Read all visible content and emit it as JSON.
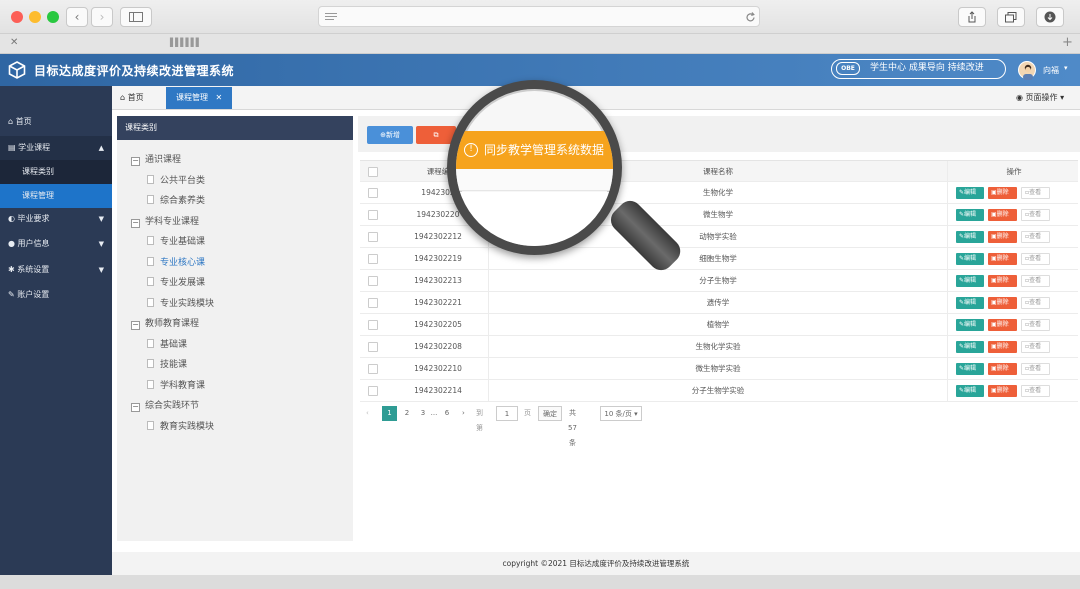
{
  "browser": {
    "tab_title": "▌▌▌▌▌▌",
    "close_tab": "✕",
    "new_tab": "+"
  },
  "app": {
    "title": "目标达成度评价及持续改进管理系统",
    "obe_badge": "OBE",
    "obe_slogan": "学生中心  成果导向  持续改进",
    "user_name": "向福"
  },
  "sidebar": {
    "items": [
      {
        "label": "首页",
        "icon": "home-icon"
      },
      {
        "label": "学业课程",
        "icon": "document-icon",
        "expanded": true
      },
      {
        "label": "课程类别",
        "sub": true
      },
      {
        "label": "课程管理",
        "sub": true,
        "active": true
      },
      {
        "label": "毕业要求",
        "icon": "target-icon"
      },
      {
        "label": "用户信息",
        "icon": "user-icon"
      },
      {
        "label": "系统设置",
        "icon": "gear-icon"
      },
      {
        "label": "账户设置",
        "icon": "edit-icon"
      }
    ]
  },
  "tabs": {
    "home": "首页",
    "active": "课程管理",
    "page_ops": "页面操作"
  },
  "category_panel": {
    "header": "课程类别",
    "tree": [
      {
        "label": "通识课程",
        "level": 0
      },
      {
        "label": "公共平台类",
        "level": 1
      },
      {
        "label": "综合素养类",
        "level": 1
      },
      {
        "label": "学科专业课程",
        "level": 0
      },
      {
        "label": "专业基础课",
        "level": 1
      },
      {
        "label": "专业核心课",
        "level": 1,
        "selected": true
      },
      {
        "label": "专业发展课",
        "level": 1
      },
      {
        "label": "专业实践模块",
        "level": 1
      },
      {
        "label": "教师教育课程",
        "level": 0
      },
      {
        "label": "基础课",
        "level": 1
      },
      {
        "label": "技能课",
        "level": 1
      },
      {
        "label": "学科教育课",
        "level": 1
      },
      {
        "label": "综合实践环节",
        "level": 0
      },
      {
        "label": "教育实践模块",
        "level": 1
      }
    ]
  },
  "toolbar": {
    "add_label": "新增",
    "sync_label": "同步教学管理系统数据"
  },
  "table": {
    "headers": {
      "code": "课程编",
      "name": "课程名称",
      "ops": "操作"
    },
    "rows": [
      {
        "code": "1942302",
        "name": "生物化学"
      },
      {
        "code": "194230220",
        "name": "微生物学"
      },
      {
        "code": "1942302212",
        "name": "动物学实验"
      },
      {
        "code": "1942302219",
        "name": "细胞生物学"
      },
      {
        "code": "1942302213",
        "name": "分子生物学"
      },
      {
        "code": "1942302221",
        "name": "遗传学"
      },
      {
        "code": "1942302205",
        "name": "植物学"
      },
      {
        "code": "1942302208",
        "name": "生物化学实验"
      },
      {
        "code": "1942302210",
        "name": "微生物学实验"
      },
      {
        "code": "1942302214",
        "name": "分子生物学实验"
      }
    ],
    "op_edit": "编辑",
    "op_delete": "删除",
    "op_view": "查看"
  },
  "pager": {
    "prev": "‹",
    "pages": [
      "1",
      "2",
      "3",
      "...",
      "6"
    ],
    "next": "›",
    "goto_label": "到第",
    "goto_value": "1",
    "page_unit": "页",
    "confirm": "确定",
    "total": "共 57 条",
    "page_size": "10 条/页"
  },
  "footer": {
    "copyright": "copyright ©2021 目标达成度评价及持续改进管理系统"
  },
  "colors": {
    "header_blue": "#3a74b6",
    "sidebar": "#2b3a55",
    "accent_blue": "#1e74c9",
    "edit_green": "#29a599",
    "delete_orange": "#ee5f39",
    "banner_orange": "#f6a31d",
    "pager_active": "#2f9c94"
  }
}
